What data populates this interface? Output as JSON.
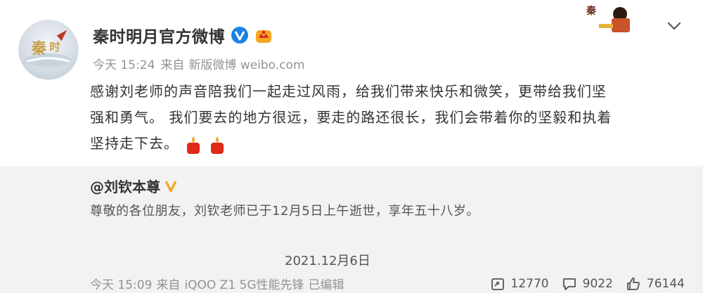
{
  "post": {
    "author": "秦时明月官方微博",
    "time": "今天 15:24",
    "source_prefix": "来自",
    "source": "新版微博 weibo.com",
    "text_line1": "感谢刘老师的声音陪我们一起走过风雨，给我们带来快乐和微笑，更带给我们坚",
    "text_line2": "强和勇气。 我们要去的地方很远，要走的路还很长，我们会带着你的坚毅和执着",
    "text_line3": "坚持走下去。"
  },
  "repost": {
    "author": "@刘钦本尊",
    "text": "尊敬的各位朋友，刘钦老师已于12月5日上午逝世，享年五十八岁。",
    "date": "2021.12月6日"
  },
  "footer": {
    "time": "今天 15:09",
    "source_prefix": "来自",
    "source": "iQOO Z1 5G性能先锋",
    "edited": "已编辑",
    "repost_count": "12770",
    "comment_count": "9022",
    "like_count": "76144"
  },
  "icons": {
    "verified": "verified-v-icon",
    "member": "member-crown-icon",
    "candle": "candle-emoji-icon",
    "more": "chevron-down-icon",
    "repost": "repost-icon",
    "comment": "comment-icon",
    "like": "like-icon"
  },
  "colors": {
    "accent_orange": "#f5a623",
    "muted_text": "#939393",
    "repost_bg": "#f2f2f2"
  }
}
